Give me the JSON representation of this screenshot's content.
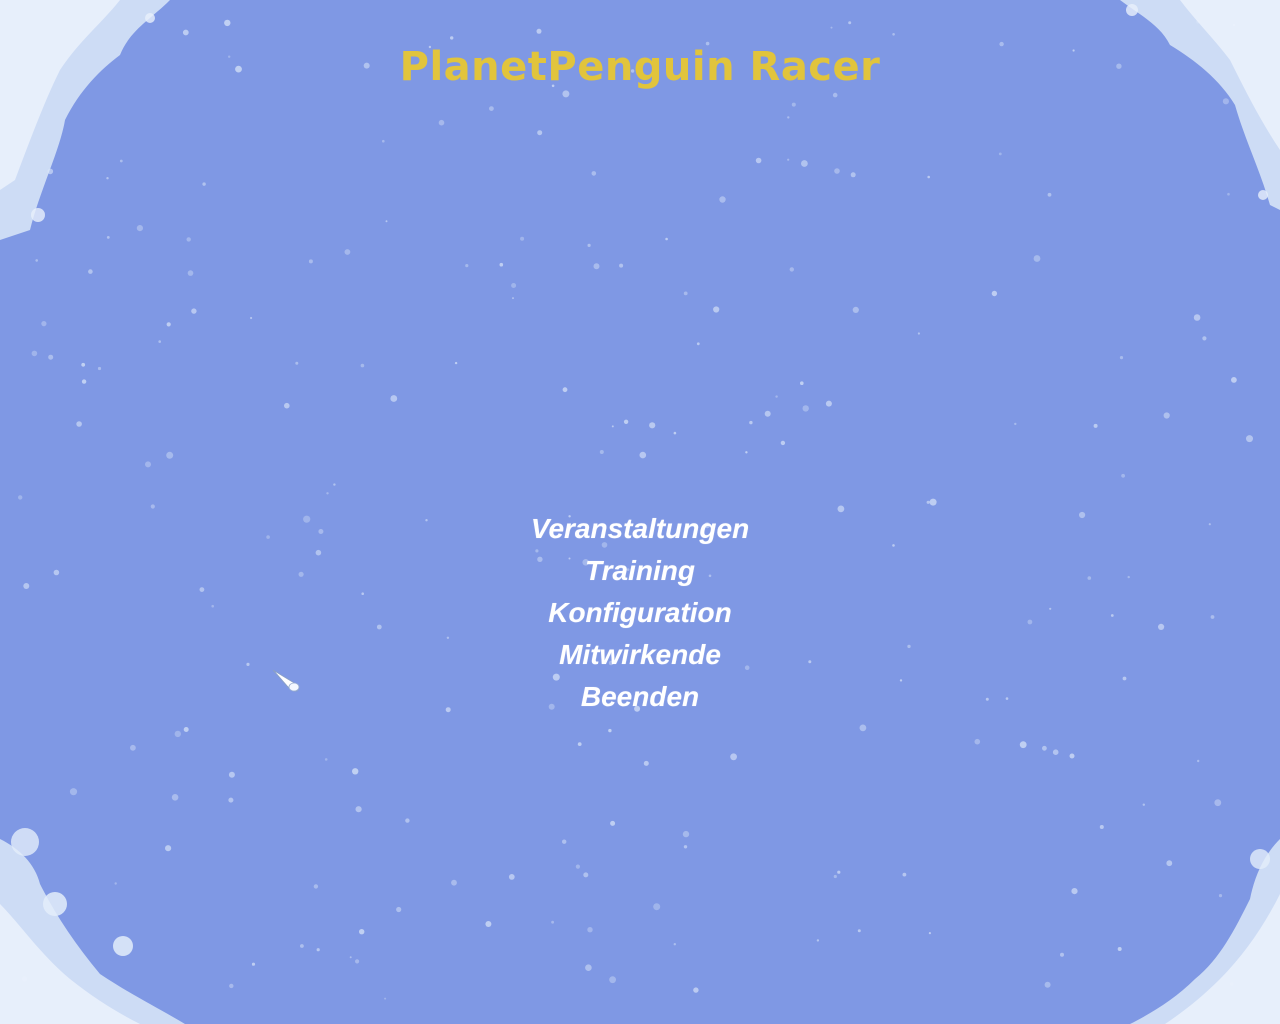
{
  "game": {
    "title": "PlanetPenguin Racer"
  },
  "menu": {
    "items": [
      {
        "label": "Veranstaltungen"
      },
      {
        "label": "Training"
      },
      {
        "label": "Konfiguration"
      },
      {
        "label": "Mitwirkende"
      },
      {
        "label": "Beenden"
      }
    ]
  },
  "theme": {
    "background": "#7f98e4",
    "title_color": "#e1c43c",
    "menu_color": "#ffffff",
    "frost_color": "#dbe8f8"
  },
  "icons": {
    "cursor": "snowball-cursor-icon",
    "background": "falling-snowflakes",
    "corners": "frost-corner-decoration"
  }
}
